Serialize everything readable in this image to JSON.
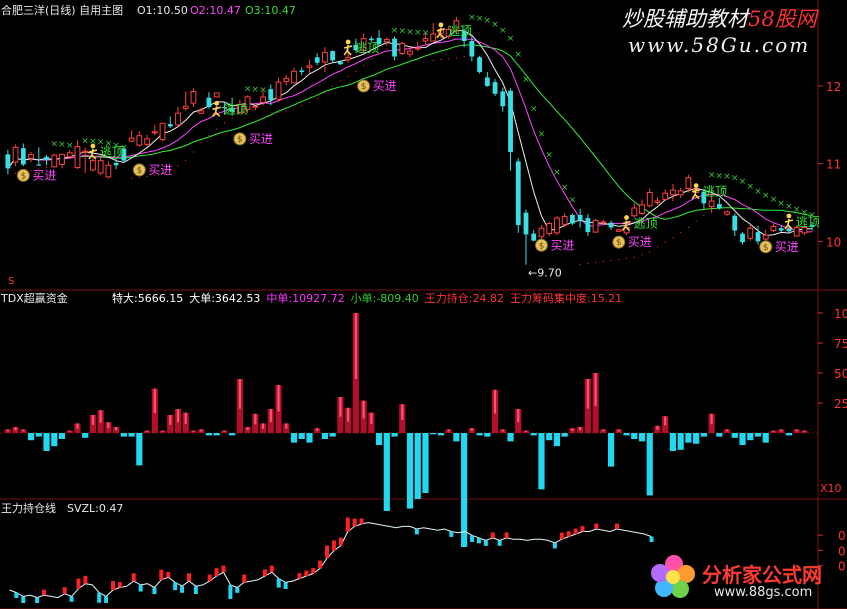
{
  "main": {
    "title": "合肥三洋(日线) 自用主图",
    "o1": "O1:10.50",
    "o2": "O2:10.47",
    "o3": "O3:10.47",
    "axis_labels": [
      "12",
      "11",
      "10"
    ],
    "low_label": "←9.70",
    "corner_mark": "S",
    "buy_text": "买进",
    "escape_text": "逃顶",
    "candles": [
      [
        11.12,
        10.94,
        10.87,
        11.18
      ],
      [
        11.02,
        11.21,
        10.97,
        11.25
      ],
      [
        11.2,
        10.99,
        10.97,
        11.26
      ],
      [
        11.07,
        11.12,
        11.02,
        11.15
      ],
      [
        10.99,
        10.98,
        10.97,
        11.21
      ],
      [
        11.09,
        11.05,
        10.98,
        11.11
      ],
      [
        10.96,
        11.11,
        10.95,
        11.13
      ],
      [
        10.99,
        11.12,
        10.94,
        11.13
      ],
      [
        11.09,
        11.14,
        11.06,
        11.18
      ],
      [
        10.95,
        11.22,
        10.94,
        11.3
      ],
      [
        11.15,
        11.16,
        10.88,
        11.21
      ],
      [
        10.92,
        11.04,
        10.9,
        11.07
      ],
      [
        10.88,
        11.04,
        10.85,
        11.1
      ],
      [
        10.83,
        10.98,
        10.81,
        11.03
      ],
      [
        11.01,
        10.98,
        10.93,
        11.07
      ],
      [
        11.19,
        11.04,
        11.02,
        11.21
      ],
      [
        11.29,
        11.33,
        11.28,
        11.43
      ],
      [
        11.24,
        11.36,
        11.22,
        11.42
      ],
      [
        11.25,
        11.32,
        11.22,
        11.37
      ],
      [
        11.4,
        11.41,
        11.37,
        11.5
      ],
      [
        11.31,
        11.52,
        11.29,
        11.52
      ],
      [
        11.51,
        11.48,
        11.46,
        11.61
      ],
      [
        11.5,
        11.65,
        11.48,
        11.73
      ],
      [
        11.71,
        11.74,
        11.68,
        11.93
      ],
      [
        11.78,
        11.93,
        11.73,
        11.97
      ],
      [
        11.65,
        11.68,
        11.64,
        11.72
      ],
      [
        11.85,
        11.73,
        11.71,
        11.92
      ],
      [
        11.86,
        11.91,
        11.85,
        11.91
      ],
      [
        11.73,
        11.72,
        11.63,
        11.8
      ],
      [
        11.72,
        11.67,
        11.62,
        11.85
      ],
      [
        11.66,
        11.76,
        11.64,
        11.82
      ],
      [
        11.7,
        11.86,
        11.65,
        11.88
      ],
      [
        11.74,
        11.74,
        11.69,
        11.74
      ],
      [
        11.79,
        11.86,
        11.75,
        11.93
      ],
      [
        11.96,
        11.82,
        11.75,
        12.02
      ],
      [
        11.83,
        12.05,
        11.8,
        12.11
      ],
      [
        12.06,
        12.1,
        12.01,
        12.14
      ],
      [
        12.04,
        12.19,
        12.04,
        12.24
      ],
      [
        12.2,
        12.18,
        12.14,
        12.24
      ],
      [
        12.24,
        12.26,
        12.16,
        12.34
      ],
      [
        12.37,
        12.3,
        12.27,
        12.42
      ],
      [
        12.31,
        12.43,
        12.18,
        12.5
      ],
      [
        12.45,
        12.33,
        12.3,
        12.46
      ],
      [
        12.31,
        12.28,
        12.27,
        12.33
      ],
      [
        12.34,
        12.37,
        12.3,
        12.52
      ],
      [
        12.53,
        12.46,
        12.44,
        12.61
      ],
      [
        12.46,
        12.61,
        12.43,
        12.68
      ],
      [
        12.61,
        12.59,
        12.57,
        12.64
      ],
      [
        12.62,
        12.54,
        12.52,
        12.72
      ],
      [
        12.57,
        12.6,
        12.52,
        12.63
      ],
      [
        12.61,
        12.38,
        12.33,
        12.64
      ],
      [
        12.42,
        12.55,
        12.4,
        12.57
      ],
      [
        12.41,
        12.45,
        12.37,
        12.5
      ],
      [
        12.49,
        12.49,
        12.45,
        12.57
      ],
      [
        12.58,
        12.61,
        12.52,
        12.68
      ],
      [
        12.58,
        12.67,
        12.58,
        12.81
      ],
      [
        12.68,
        12.73,
        12.61,
        12.75
      ],
      [
        12.64,
        12.73,
        12.61,
        12.77
      ],
      [
        12.71,
        12.84,
        12.67,
        12.89
      ],
      [
        12.71,
        12.58,
        12.5,
        12.74
      ],
      [
        12.58,
        12.38,
        12.32,
        12.64
      ],
      [
        12.37,
        12.18,
        12.16,
        12.39
      ],
      [
        12.11,
        12.0,
        11.99,
        12.18
      ],
      [
        12.05,
        11.9,
        11.87,
        12.09
      ],
      [
        11.93,
        11.74,
        11.67,
        11.98
      ],
      [
        11.94,
        11.15,
        10.91,
        11.97
      ],
      [
        11.03,
        10.21,
        10.11,
        11.07
      ],
      [
        10.37,
        10.09,
        9.7,
        10.41
      ],
      [
        10.1,
        10.01,
        10.0,
        10.15
      ],
      [
        10.06,
        10.17,
        9.98,
        10.21
      ],
      [
        10.1,
        10.23,
        10.07,
        10.25
      ],
      [
        10.11,
        10.3,
        10.08,
        10.33
      ],
      [
        10.22,
        10.32,
        10.19,
        10.36
      ],
      [
        10.34,
        10.23,
        10.21,
        10.36
      ],
      [
        10.34,
        10.27,
        10.18,
        10.42
      ],
      [
        10.3,
        10.12,
        10.07,
        10.35
      ],
      [
        10.12,
        10.27,
        10.11,
        10.29
      ],
      [
        10.24,
        10.25,
        10.21,
        10.28
      ],
      [
        10.24,
        10.18,
        10.15,
        10.27
      ],
      [
        10.13,
        10.15,
        10.12,
        10.15
      ],
      [
        10.11,
        10.18,
        10.08,
        10.21
      ],
      [
        10.33,
        10.43,
        10.31,
        10.49
      ],
      [
        10.36,
        10.47,
        10.34,
        10.54
      ],
      [
        10.46,
        10.63,
        10.44,
        10.68
      ],
      [
        10.5,
        10.52,
        10.47,
        10.57
      ],
      [
        10.54,
        10.62,
        10.52,
        10.67
      ],
      [
        10.6,
        10.66,
        10.52,
        10.74
      ],
      [
        10.6,
        10.65,
        10.56,
        10.69
      ],
      [
        10.68,
        10.82,
        10.63,
        10.86
      ],
      [
        10.63,
        10.67,
        10.62,
        10.73
      ],
      [
        10.64,
        10.49,
        10.42,
        10.68
      ],
      [
        10.45,
        10.52,
        10.37,
        10.6
      ],
      [
        10.48,
        10.43,
        10.41,
        10.56
      ],
      [
        10.35,
        10.38,
        10.33,
        10.4
      ],
      [
        10.33,
        10.14,
        10.07,
        10.36
      ],
      [
        10.1,
        9.99,
        9.96,
        10.12
      ],
      [
        10.04,
        10.17,
        10.01,
        10.22
      ],
      [
        10.12,
        10.0,
        9.96,
        10.2
      ],
      [
        10.03,
        10.08,
        10.01,
        10.15
      ],
      [
        10.14,
        10.19,
        10.12,
        10.23
      ],
      [
        10.17,
        10.14,
        10.12,
        10.2
      ],
      [
        10.16,
        10.13,
        10.1,
        10.2
      ],
      [
        10.07,
        10.18,
        10.06,
        10.2
      ],
      [
        10.11,
        10.18,
        10.08,
        10.21
      ],
      [
        10.21,
        10.19,
        10.14,
        10.25
      ]
    ],
    "buy_signals": [
      {
        "i": 2,
        "price": 10.85
      },
      {
        "i": 17,
        "price": 10.92
      },
      {
        "i": 30,
        "price": 11.32
      },
      {
        "i": 46,
        "price": 12.0
      },
      {
        "i": 69,
        "price": 9.95
      },
      {
        "i": 79,
        "price": 9.99
      },
      {
        "i": 98,
        "price": 9.93
      }
    ],
    "escape_signals": [
      {
        "i": 11,
        "price": 11.15
      },
      {
        "i": 27,
        "price": 11.7
      },
      {
        "i": 44,
        "price": 12.49
      },
      {
        "i": 56,
        "price": 12.71
      },
      {
        "i": 80,
        "price": 10.23
      },
      {
        "i": 89,
        "price": 10.64
      },
      {
        "i": 101,
        "price": 10.25
      }
    ]
  },
  "fund": {
    "name": "TDX超赢资金",
    "values": [
      {
        "label": "特大",
        "value": "5666.15",
        "color": "#ffffff"
      },
      {
        "label": "大单",
        "value": "3642.53",
        "color": "#ffffff"
      },
      {
        "label": "中单",
        "value": "10927.72",
        "color": "#ff33ff"
      },
      {
        "label": "小单",
        "value": "-809.40",
        "color": "#33cc33"
      },
      {
        "label": "王力持仓",
        "value": "24.82",
        "color": "#ff3333"
      },
      {
        "label": "王力筹码集中度",
        "value": "15.21",
        "color": "#ff3333"
      }
    ],
    "axis_labels": [
      "100",
      "75",
      "50",
      "25"
    ],
    "x10": "X10",
    "bars": [
      3,
      5,
      3,
      -6,
      -3,
      -15,
      -11,
      -5,
      2,
      8,
      -4,
      15,
      19,
      9,
      5,
      -3,
      -3,
      -27,
      2,
      37,
      2,
      15,
      20,
      17,
      2,
      3,
      -2,
      -2,
      2,
      -2,
      45,
      5,
      16,
      8,
      20,
      40,
      8,
      -8,
      -5,
      -8,
      4,
      -5,
      -3,
      30,
      21,
      100,
      27,
      17,
      -10,
      -65,
      -3,
      24,
      -63,
      -55,
      -50,
      -1,
      -2,
      3,
      -7,
      -95,
      4,
      -2,
      -3,
      36,
      3,
      -7,
      20,
      2,
      -2,
      -47,
      -6,
      -11,
      -3,
      4,
      5,
      45,
      50,
      3,
      -28,
      3,
      -2,
      -5,
      -7,
      -52,
      6,
      14,
      -15,
      -14,
      -8,
      -9,
      -3,
      16,
      -3,
      3,
      -4,
      -10,
      -6,
      -3,
      -8,
      2,
      3,
      -2,
      3,
      2
    ]
  },
  "svzl": {
    "name": "王力持仓线",
    "label_value": "SVZL:0.47",
    "axis_labels": [
      "0.",
      "0.",
      "0"
    ],
    "values": [
      -0.39,
      -0.41,
      -0.44,
      -0.43,
      -0.45,
      -0.43,
      -0.44,
      -0.45,
      -0.42,
      -0.44,
      -0.38,
      -0.34,
      -0.35,
      -0.41,
      -0.44,
      -0.39,
      -0.37,
      -0.36,
      -0.32,
      -0.35,
      -0.34,
      -0.37,
      -0.31,
      -0.29,
      -0.33,
      -0.36,
      -0.32,
      -0.36,
      -0.35,
      -0.32,
      -0.28,
      -0.25,
      -0.35,
      -0.37,
      -0.33,
      -0.32,
      -0.31,
      -0.28,
      -0.25,
      -0.3,
      -0.33,
      -0.32,
      -0.3,
      -0.28,
      -0.26,
      -0.22,
      -0.14,
      -0.08,
      -0.04,
      0.07,
      0.11,
      0.13,
      0.14,
      0.13,
      0.12,
      0.11,
      0.1,
      0.11,
      0.11,
      0.09,
      0.1,
      0.09,
      0.08,
      0.09,
      0.07,
      0.06,
      0.07,
      0.04,
      0.02,
      0,
      0.02,
      0,
      0.02,
      0.01,
      0.01,
      0,
      0.01,
      0.01,
      0,
      -0.02,
      0.01,
      0.03,
      0.05,
      0.07,
      0.07,
      0.09,
      0.08,
      0.07,
      0.09,
      0.08,
      0.07,
      0.06,
      0.05,
      0.03
    ]
  },
  "watermark_top": {
    "cn": "炒股辅助教材",
    "site": "58股网",
    "url": "www.58Gu.com"
  },
  "watermark_bottom": {
    "cn": "分析家公式网",
    "url": "www.88gs.com"
  }
}
